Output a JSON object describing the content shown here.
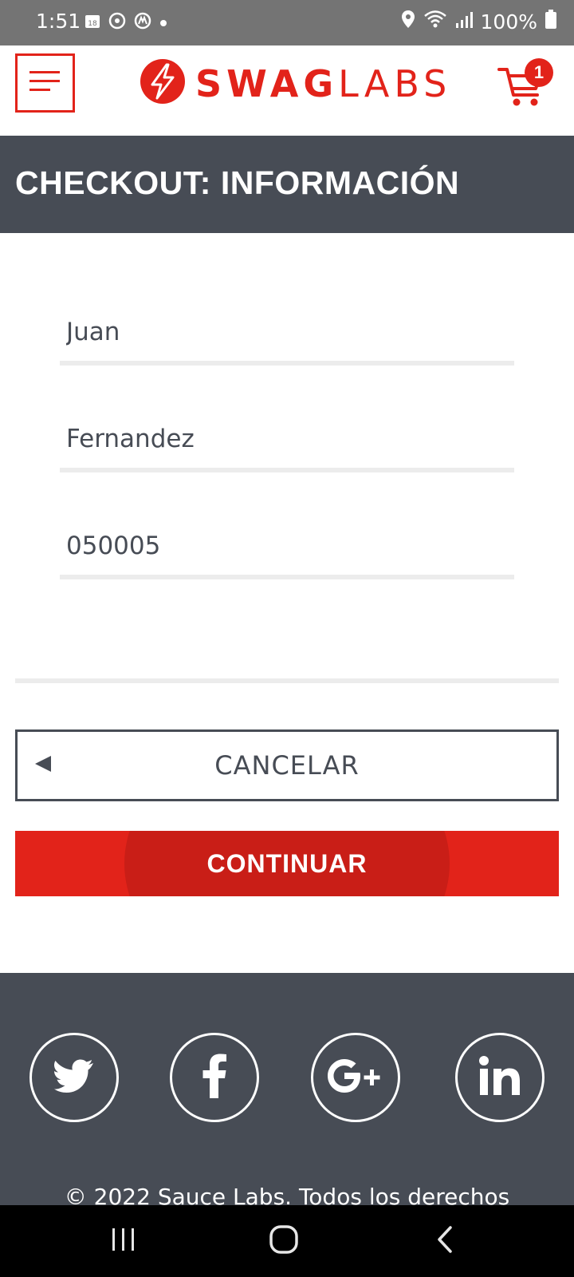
{
  "status_bar": {
    "time": "1:51",
    "battery": "100%",
    "calendar_day": "18"
  },
  "header": {
    "logo_text_bold": "SWAG",
    "logo_text_light": "LABS",
    "cart_count": "1",
    "brand_color": "#e2231a"
  },
  "page_title": "CHECKOUT: INFORMACIÓN",
  "form": {
    "first_name": "Juan",
    "last_name": "Fernandez",
    "zip_code": "050005"
  },
  "buttons": {
    "cancel": "CANCELAR",
    "continue": "CONTINUAR"
  },
  "footer": {
    "social": [
      "twitter-icon",
      "facebook-icon",
      "google-plus-icon",
      "linkedin-icon"
    ],
    "copyright": "© 2022 Sauce Labs. Todos los derechos"
  },
  "nav_bar": {
    "buttons": [
      "recent-apps",
      "home",
      "back"
    ]
  }
}
